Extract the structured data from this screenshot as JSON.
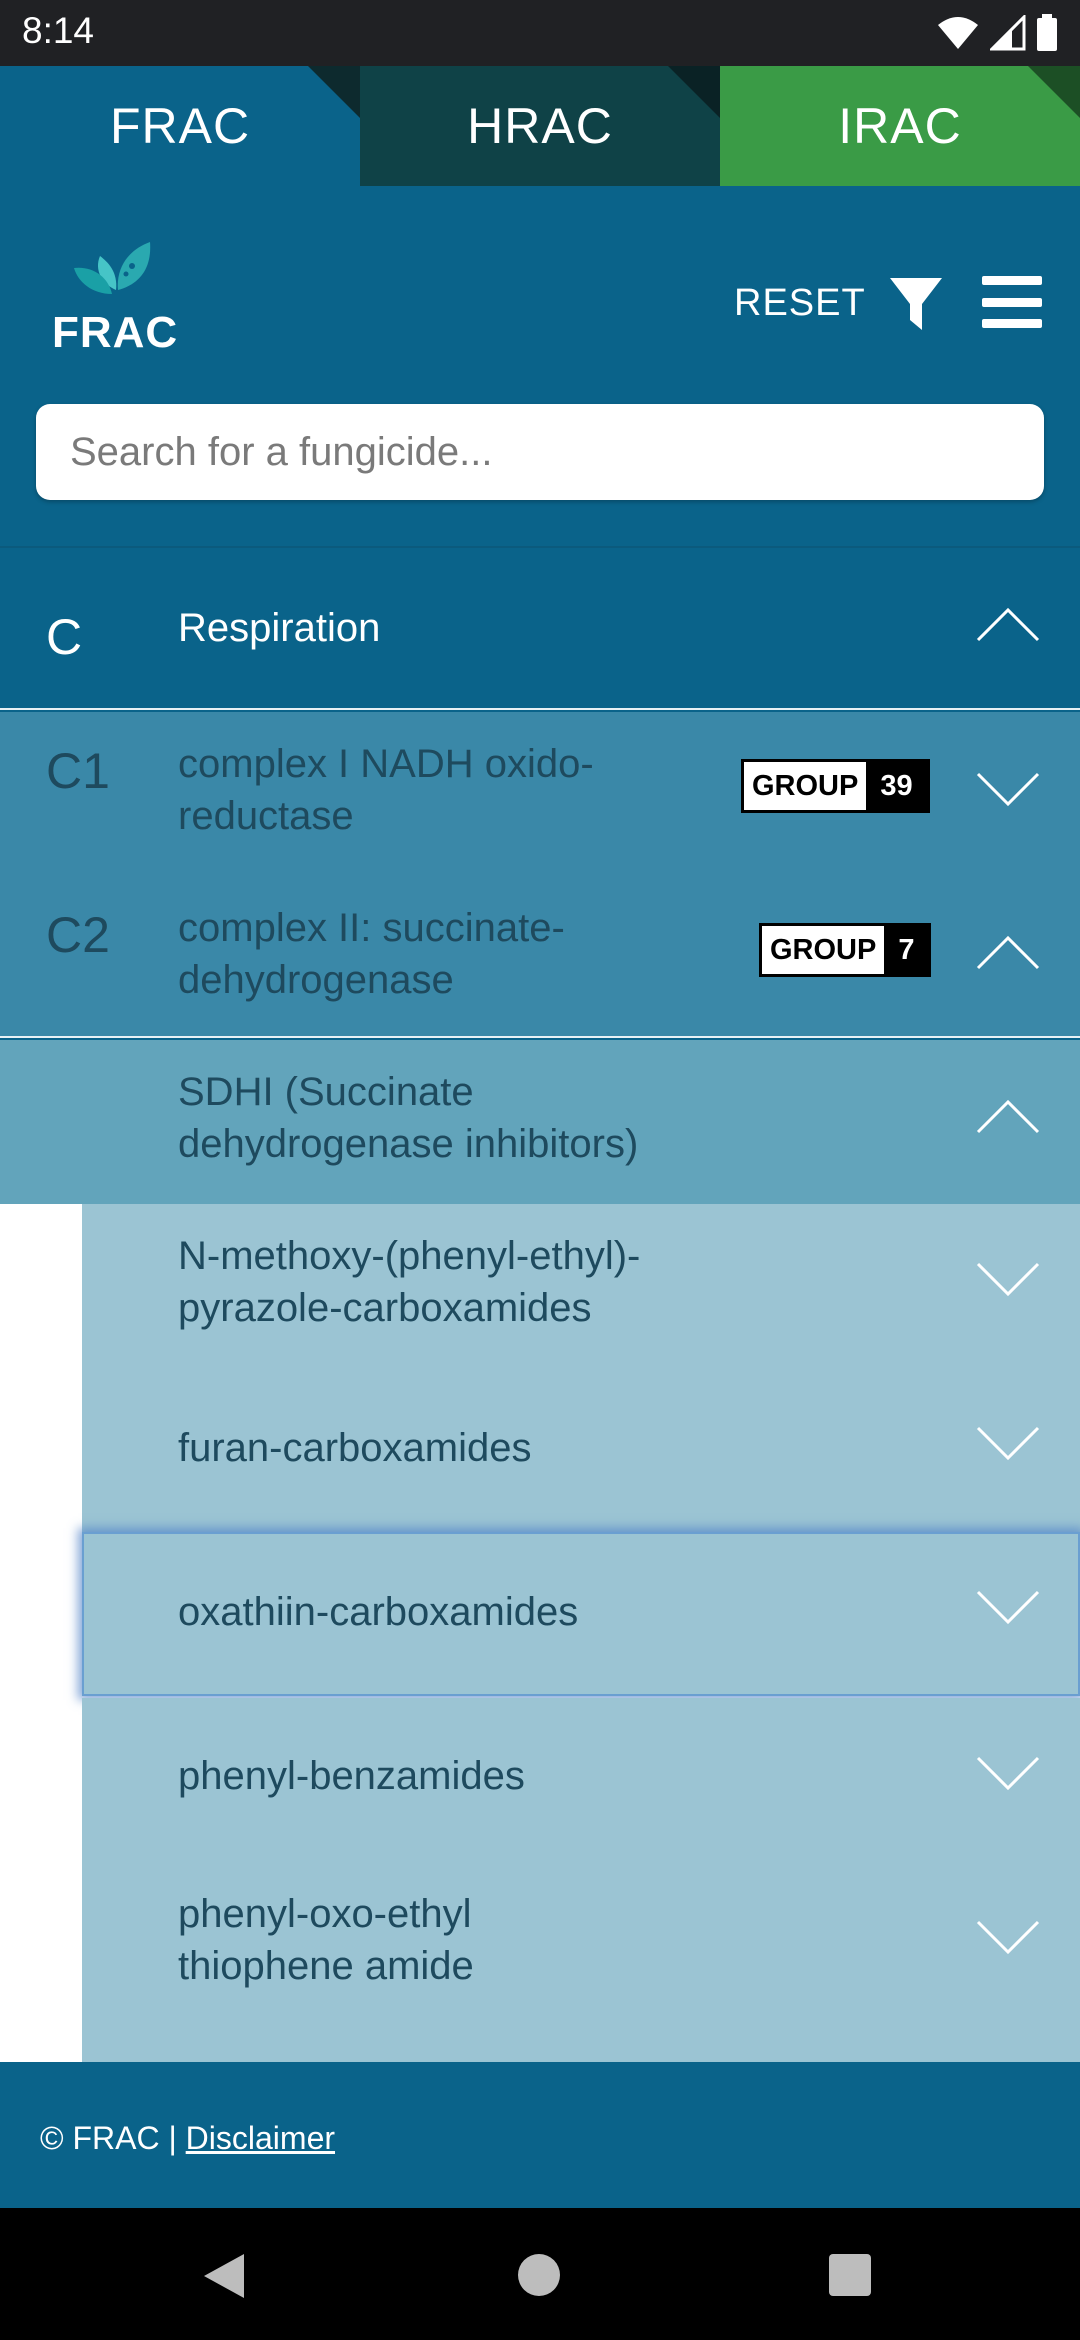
{
  "status_bar": {
    "time": "8:14",
    "icons": [
      "wifi-icon",
      "signal-icon",
      "battery-icon"
    ]
  },
  "app_tabs": [
    {
      "label": "FRAC",
      "color": "#0a638a",
      "active": true
    },
    {
      "label": "HRAC",
      "color": "#0f4247",
      "active": false
    },
    {
      "label": "IRAC",
      "color": "#3a9b46",
      "active": false
    }
  ],
  "header": {
    "logo_text": "FRAC",
    "reset_label": "RESET",
    "filter_icon": "filter-icon",
    "menu_icon": "hamburger-menu-icon",
    "search_placeholder": "Search for a fungicide...",
    "search_value": ""
  },
  "category": {
    "code": "C",
    "title": "Respiration",
    "expanded": true
  },
  "groups": [
    {
      "code": "C1",
      "title": "complex I NADH oxido-\nreductase",
      "badge_label": "GROUP",
      "badge_number": "39",
      "expanded": false
    },
    {
      "code": "C2",
      "title": "complex II: succinate-\ndehydrogenase",
      "badge_label": "GROUP",
      "badge_number": "7",
      "expanded": true
    }
  ],
  "subgroup": {
    "title": "SDHI (Succinate\ndehydrogenase inhibitors)",
    "expanded": true
  },
  "chemical_groups": [
    {
      "title": "N-methoxy-(phenyl-ethyl)-\npyrazole-carboxamides",
      "focused": false
    },
    {
      "title": "furan-carboxamides",
      "focused": false
    },
    {
      "title": "oxathiin-carboxamides",
      "focused": true
    },
    {
      "title": "phenyl-benzamides",
      "focused": false
    },
    {
      "title": "phenyl-oxo-ethyl\nthiophene amide",
      "focused": false
    }
  ],
  "footer": {
    "copyright": "© FRAC | ",
    "disclaimer_link": "Disclaimer"
  },
  "colors": {
    "primary": "#0a638a",
    "hrac": "#0f4247",
    "irac": "#3a9b46",
    "subgroup": "#62a4bb",
    "chemical_group": "#9bc4d3"
  }
}
